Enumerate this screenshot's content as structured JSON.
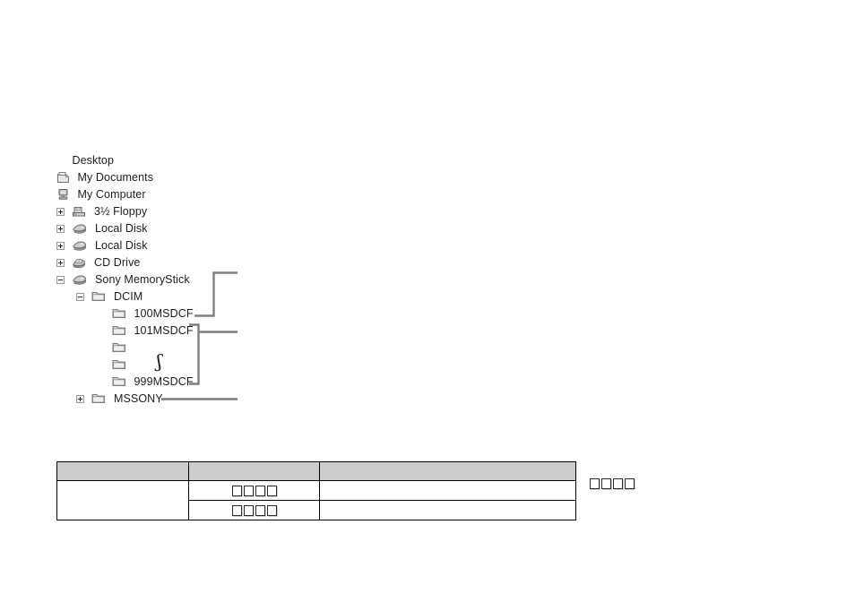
{
  "tree": {
    "name": "windows-explorer-folder-tree",
    "items": [
      {
        "label": "Desktop",
        "icon": "none",
        "expander": "none",
        "indent": 0
      },
      {
        "label": "My Documents",
        "icon": "documents-icon",
        "expander": "none",
        "indent": 1
      },
      {
        "label": "My Computer",
        "icon": "computer-icon",
        "expander": "none",
        "indent": 1
      },
      {
        "label": "3½ Floppy",
        "icon": "floppy-icon",
        "expander": "plus",
        "indent": 1
      },
      {
        "label": "Local Disk",
        "icon": "harddisk-icon",
        "expander": "plus",
        "indent": 1
      },
      {
        "label": "Local Disk",
        "icon": "harddisk-icon",
        "expander": "plus",
        "indent": 1
      },
      {
        "label": "CD Drive",
        "icon": "cddrive-icon",
        "expander": "plus",
        "indent": 1
      },
      {
        "label": "Sony MemoryStick",
        "icon": "harddisk-icon",
        "expander": "minus",
        "indent": 1
      },
      {
        "label": "DCIM",
        "icon": "folder-icon",
        "expander": "minus",
        "indent": 2
      },
      {
        "label": "100MSDCF",
        "icon": "folder-icon",
        "expander": "none",
        "indent": 4
      },
      {
        "label": "101MSDCF",
        "icon": "folder-icon",
        "expander": "none",
        "indent": 4
      },
      {
        "label": "",
        "icon": "folder-icon",
        "expander": "none",
        "indent": 4
      },
      {
        "label": "",
        "icon": "folder-icon",
        "expander": "none",
        "indent": 4,
        "squiggle": "ʃ"
      },
      {
        "label": "999MSDCF",
        "icon": "folder-icon",
        "expander": "none",
        "indent": 4
      },
      {
        "label": "MSSONY",
        "icon": "folder-icon",
        "expander": "plus",
        "indent": 2
      }
    ]
  },
  "connectors": {
    "line_color": "#7f7f7f",
    "leaders": [
      {
        "name": "leader-100msdcf"
      },
      {
        "name": "leader-101-999msdcf-bracket"
      },
      {
        "name": "leader-mssony"
      }
    ]
  },
  "table": {
    "name": "folder-description-table",
    "header": [
      "",
      "",
      ""
    ],
    "rows": [
      {
        "cells": [
          "",
          "□□□□",
          ""
        ]
      },
      {
        "cells": [
          "",
          "□□□□",
          ""
        ]
      }
    ],
    "tofu_count": 4
  },
  "aside": {
    "name": "aside-missing-glyph-group",
    "tofu_count": 4
  }
}
